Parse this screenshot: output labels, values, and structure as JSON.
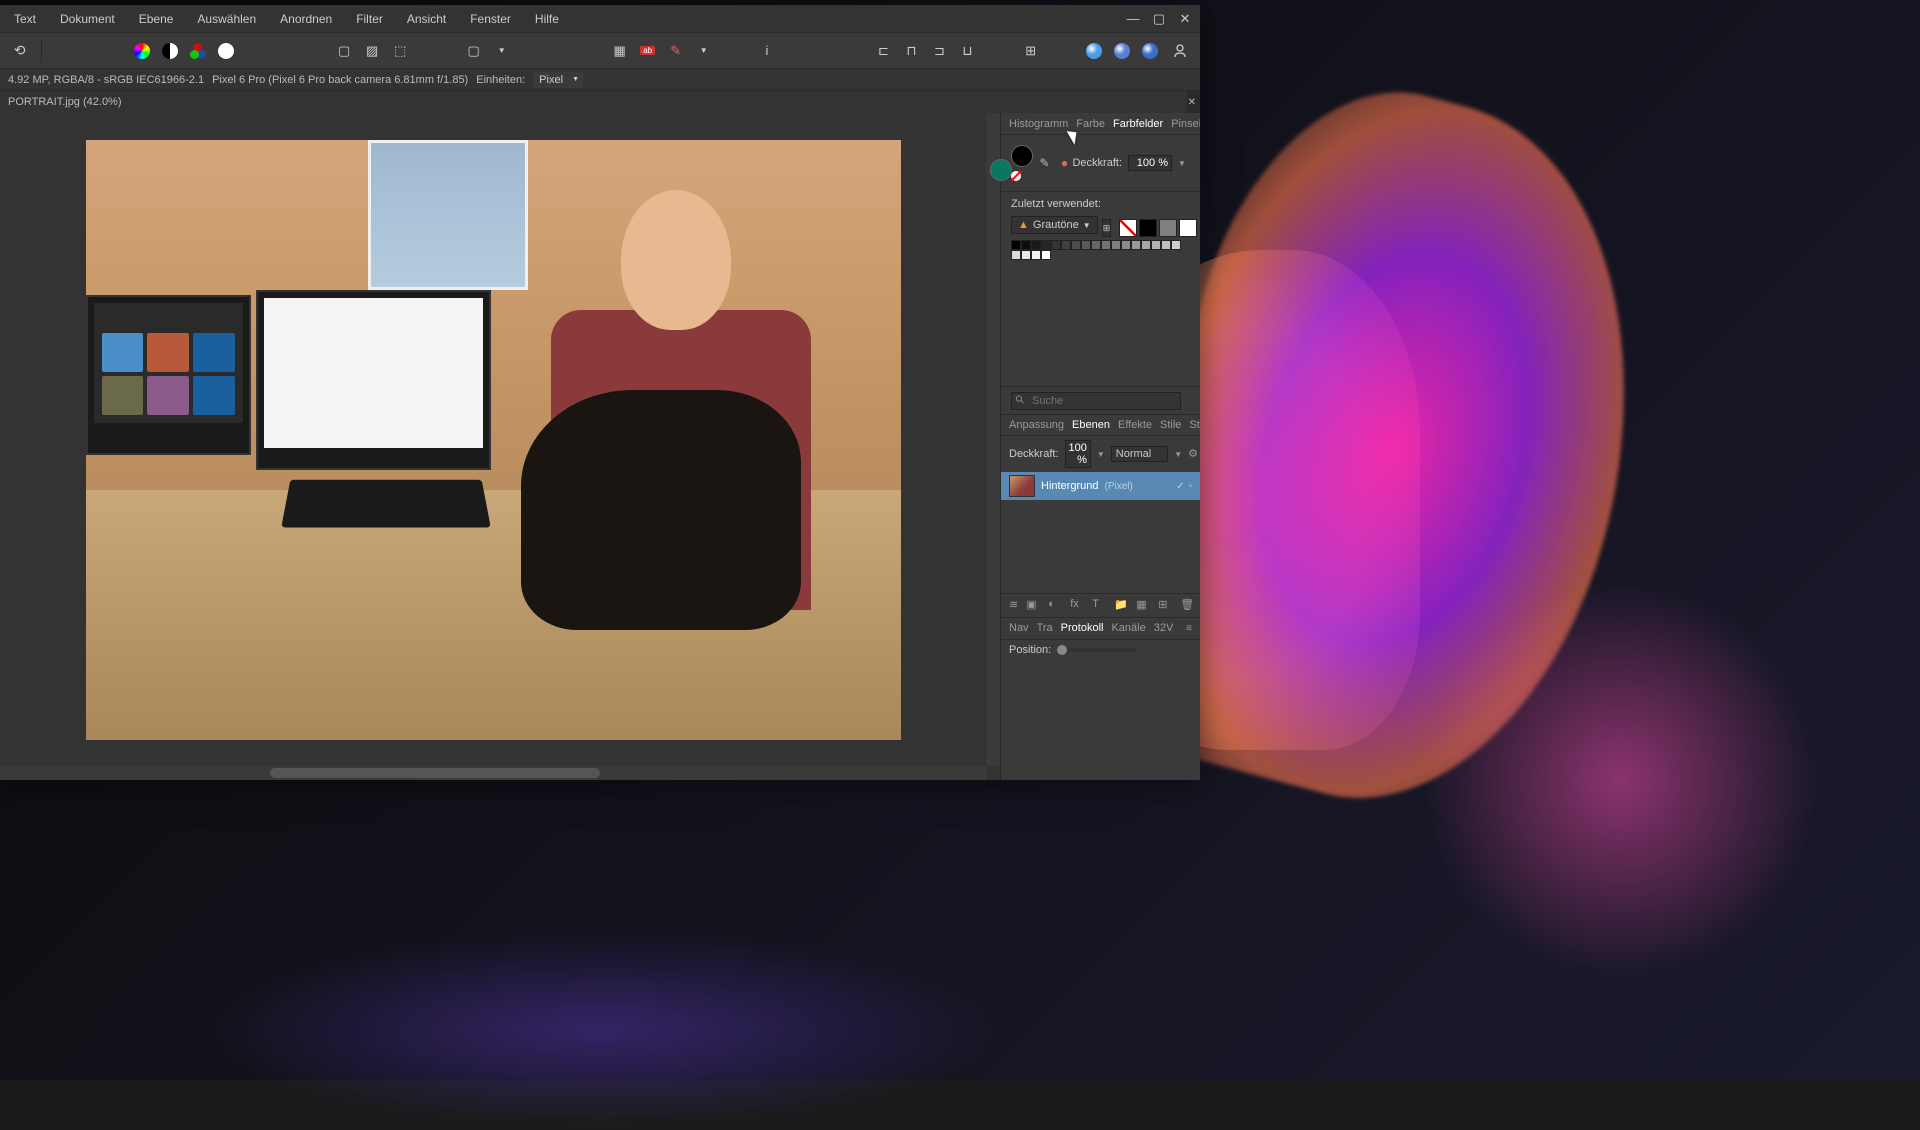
{
  "menu": {
    "items": [
      "Text",
      "Dokument",
      "Ebene",
      "Auswählen",
      "Anordnen",
      "Filter",
      "Ansicht",
      "Fenster",
      "Hilfe"
    ]
  },
  "info_bar": {
    "specs": "4.92 MP, RGBA/8 - sRGB IEC61966-2.1",
    "camera": "Pixel 6 Pro (Pixel 6 Pro back camera 6.81mm f/1.85)",
    "units_label": "Einheiten:",
    "units_value": "Pixel"
  },
  "tab": {
    "title": "PORTRAIT.jpg (42.0%)"
  },
  "panel_tabs_top": {
    "items": [
      "Histogramm",
      "Farbe",
      "Farbfelder",
      "Pinsel"
    ],
    "active_index": 2
  },
  "color": {
    "opacity_label": "Deckkraft:",
    "opacity_value": "100 %",
    "recent_label": "Zuletzt verwendet:",
    "palette_name": "Grautöne",
    "front_color": "#000000",
    "back_color": "#0a7860"
  },
  "swatches_gray": [
    "#000000",
    "#0d0d0d",
    "#1a1a1a",
    "#262626",
    "#333333",
    "#404040",
    "#4d4d4d",
    "#595959",
    "#666666",
    "#737373",
    "#808080",
    "#8c8c8c",
    "#999999",
    "#a6a6a6",
    "#b3b3b3",
    "#bfbfbf",
    "#cccccc",
    "#d9d9d9",
    "#e6e6e6",
    "#f2f2f2",
    "#ffffff"
  ],
  "search": {
    "placeholder": "Suche"
  },
  "layers_tabs": {
    "items": [
      "Anpassung",
      "Ebenen",
      "Effekte",
      "Stile",
      "Stock"
    ],
    "active_index": 1
  },
  "layers": {
    "opacity_label": "Deckkraft:",
    "opacity_value": "100 %",
    "blend_mode": "Normal",
    "items": [
      {
        "name": "Hintergrund",
        "type": "(Pixel)"
      }
    ]
  },
  "bottom_tabs": {
    "items": [
      "Nav",
      "Tra",
      "Protokoll",
      "Kanäle",
      "32V"
    ],
    "active_index": 2
  },
  "position": {
    "label": "Position:"
  }
}
